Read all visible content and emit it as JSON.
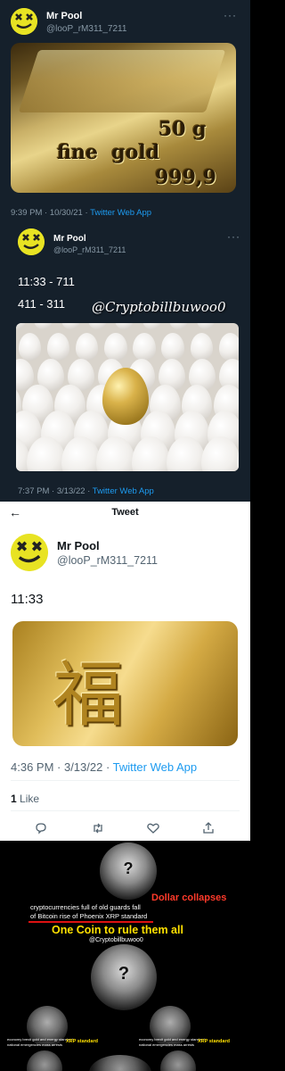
{
  "tweet1": {
    "display_name": "Mr Pool",
    "handle": "@looP_rM311_7211",
    "more": "···",
    "image_text": {
      "line1": "50 g",
      "line2": "fine  gold",
      "line3": "999,9"
    },
    "time": "9:39 PM · 10/30/21 · ",
    "app": "Twitter Web App"
  },
  "tweet2": {
    "display_name": "Mr Pool",
    "handle": "@looP_rM311_7211",
    "more": "···",
    "line1": "11:33 - 711",
    "line2": "411 - 311",
    "watermark": "@Cryptobillbuwoo0",
    "time": "7:37 PM · 3/13/22 · ",
    "app": "Twitter Web App"
  },
  "tweet3": {
    "back_arrow": "←",
    "header_title": "Tweet",
    "display_name": "Mr Pool",
    "handle": "@looP_rM311_7211",
    "text": "11:33",
    "image_character": "福",
    "time": "4:36 PM · 3/13/22 · ",
    "app": "Twitter Web App",
    "likes_count": "1",
    "likes_label": " Like",
    "actions": [
      "reply-icon",
      "retweet-icon",
      "like-icon",
      "share-icon"
    ]
  },
  "video": {
    "dollar_collapses": "Dollar collapses",
    "line1": "cryptocurrencies full of old guards fall",
    "line2": "of Bitcoin rise of Phoenix XRP standard",
    "one_coin": "One Coin to rule them all",
    "watermark": "@Cryptobillbuwoo0",
    "small_text1": "economy brexit gold and energy standard",
    "small_text2": "national emergencies mass arrests",
    "xrp_standard": "XRP standard",
    "small_text1b": "economy brexit gold and energy standard",
    "small_text2b": "national emergencies mass arrests",
    "xrp_standard_b": "XRP standard",
    "anon_symbol": "?"
  },
  "colors": {
    "dark_bg": "#15202b",
    "accent_blue": "#1d9bf0",
    "avatar_yellow": "#e8e323",
    "red_text": "#ff3a2a",
    "yellow_text": "#ffe000"
  }
}
